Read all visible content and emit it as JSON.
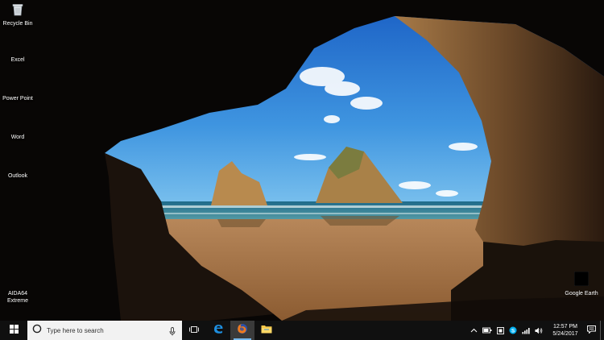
{
  "desktop": {
    "icons": [
      {
        "label": "Recycle Bin",
        "icon": "recycle-bin-icon"
      },
      {
        "label": "Excel",
        "icon": "excel-icon"
      },
      {
        "label": "Power Point",
        "icon": "powerpoint-icon"
      },
      {
        "label": "Word",
        "icon": "word-icon"
      },
      {
        "label": "Outlook",
        "icon": "outlook-icon"
      },
      {
        "label": "AIDA64 Extreme",
        "icon": "aida64-icon"
      },
      {
        "label": "Google Earth",
        "icon": "google-earth-icon"
      }
    ]
  },
  "taskbar": {
    "search_placeholder": "Type here to search",
    "apps": [
      {
        "name": "Task View",
        "icon": "task-view-icon"
      },
      {
        "name": "Microsoft Edge",
        "icon": "edge-icon"
      },
      {
        "name": "Firefox",
        "icon": "firefox-icon"
      },
      {
        "name": "File Explorer",
        "icon": "file-explorer-icon"
      }
    ],
    "tray": {
      "time": "12:57 PM",
      "date": "5/24/2017"
    }
  },
  "colors": {
    "taskbar": "#101010",
    "search_bg": "#f2f2f2",
    "accent": "#76b9ed"
  }
}
